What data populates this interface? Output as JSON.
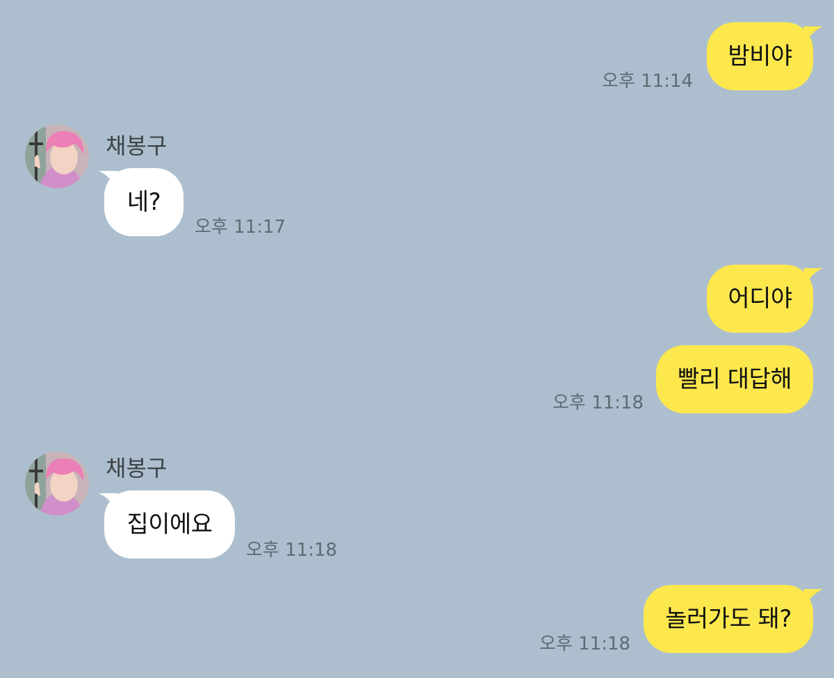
{
  "theme": {
    "background": "#adbfce",
    "outgoing_bubble": "#fce84d",
    "incoming_bubble": "#ffffff"
  },
  "messages": [
    {
      "direction": "outgoing",
      "text": "밤비야",
      "time": "오후 11:14"
    },
    {
      "direction": "incoming",
      "sender": "채봉구",
      "avatar": "profile-avatar-icon",
      "text": "네?",
      "time": "오후 11:17"
    },
    {
      "direction": "outgoing",
      "text": "어디야"
    },
    {
      "direction": "outgoing",
      "text": "빨리 대답해",
      "time": "오후 11:18"
    },
    {
      "direction": "incoming",
      "sender": "채봉구",
      "avatar": "profile-avatar-icon",
      "text": "집이에요",
      "time": "오후 11:18"
    },
    {
      "direction": "outgoing",
      "text": "놀러가도 돼?",
      "time": "오후 11:18"
    }
  ]
}
